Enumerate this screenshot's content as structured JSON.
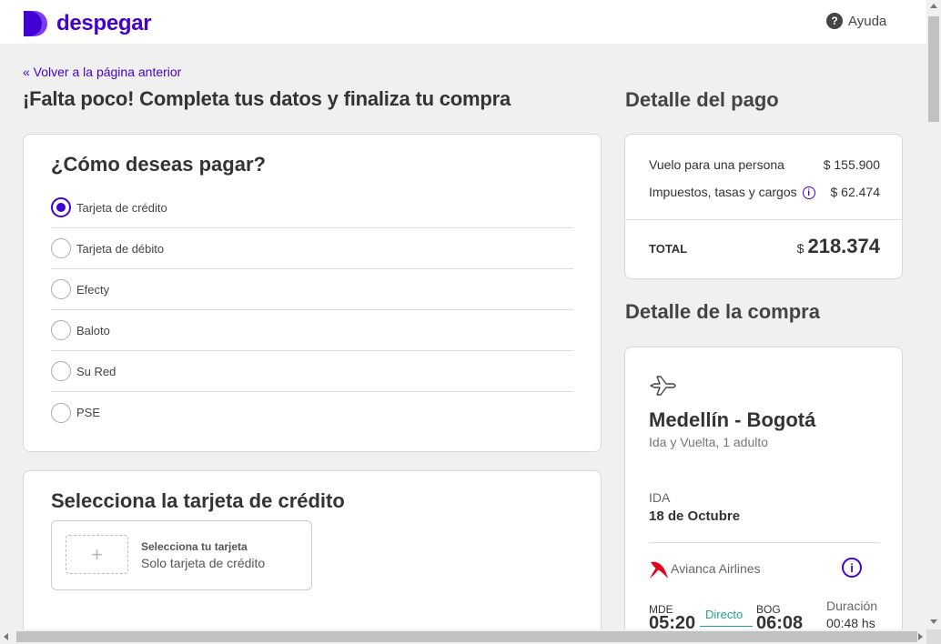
{
  "header": {
    "brand": "despegar",
    "brand_color": "#4300d2",
    "help_label": "Ayuda",
    "help_icon": "question-circle-icon",
    "help_icon_glyph": "?"
  },
  "nav": {
    "back_link": "« Volver a la página anterior"
  },
  "page": {
    "title": "¡Falta poco! Completa tus datos y finaliza tu compra"
  },
  "payment": {
    "title": "¿Cómo deseas pagar?",
    "selected": "Tarjeta de crédito",
    "options": [
      {
        "label": "Tarjeta de crédito",
        "checked": true
      },
      {
        "label": "Tarjeta de débito",
        "checked": false
      },
      {
        "label": "Efecty",
        "checked": false
      },
      {
        "label": "Baloto",
        "checked": false
      },
      {
        "label": "Su Red",
        "checked": false
      },
      {
        "label": "PSE",
        "checked": false
      }
    ]
  },
  "credit_card": {
    "title": "Selecciona la tarjeta de crédito",
    "plus_glyph": "+",
    "select_label": "Selecciona tu tarjeta",
    "select_sub": "Solo tarjeta de crédito"
  },
  "payment_detail": {
    "title": "Detalle del pago",
    "flight_label": "Vuelo para una persona",
    "flight_amount": "$ 155.900",
    "taxes_label": "Impuestos, tasas y cargos",
    "taxes_amount": "$ 62.474",
    "info_glyph": "i",
    "total_label": "TOTAL",
    "total_currency": "$",
    "total_amount": "218.374"
  },
  "purchase_detail": {
    "title": "Detalle de la compra",
    "route": "Medellín - Bogotá",
    "route_sub": "Ida y Vuelta, 1 adulto",
    "leg_label": "IDA",
    "leg_date": "18 de Octubre",
    "airline": "Avianca Airlines",
    "airline_color": "#e2001a",
    "info_glyph": "i",
    "departure_code": "MDE",
    "departure_time": "05:20",
    "stops": "Directo",
    "stops_color": "#23a08c",
    "arrival_code": "BOG",
    "arrival_time": "06:08",
    "duration_label": "Duración",
    "duration_value": "00:48 hs"
  }
}
